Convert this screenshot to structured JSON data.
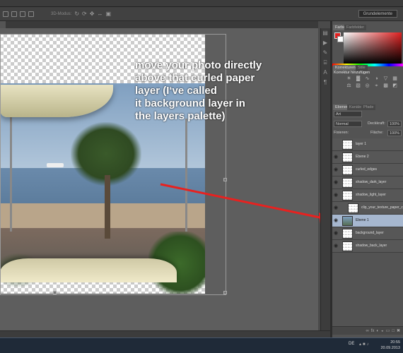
{
  "app": {
    "workspace_label": "Grundelemente",
    "options_label": "3D-Modus:"
  },
  "canvas": {
    "callout_lines": [
      "move your photo directly",
      "above that curled paper",
      "layer (I‘ve called",
      "it background layer in",
      "the layers palette)"
    ],
    "annotation_color": "#e8211f"
  },
  "color_panel": {
    "tabs": [
      "Farbe",
      "Farbfelder"
    ],
    "foreground": "#e02020",
    "background": "#ffffff"
  },
  "adjustments_panel": {
    "tabs": [
      "Korrekturen",
      "Stile"
    ],
    "heading": "Korrektur hinzufügen"
  },
  "layers_panel": {
    "tabs": [
      "Ebenen",
      "Kanäle",
      "Pfade"
    ],
    "filter": "Art",
    "blend_mode": "Normal",
    "opacity_label": "Deckkraft:",
    "opacity_value": "100%",
    "lock_label": "Fixieren:",
    "fill_label": "Fläche:",
    "fill_value": "100%",
    "layers": [
      {
        "name": "layer 1",
        "visible": false,
        "selected": false,
        "clip": false
      },
      {
        "name": "Ebene 2",
        "visible": true,
        "selected": false,
        "clip": false
      },
      {
        "name": "curled_edges",
        "visible": true,
        "selected": false,
        "clip": false
      },
      {
        "name": "shadow_dark_layer",
        "visible": true,
        "selected": false,
        "clip": false
      },
      {
        "name": "shadow_light_layer",
        "visible": true,
        "selected": false,
        "clip": false
      },
      {
        "name": "clip_your_texture_paper_col",
        "visible": true,
        "selected": false,
        "clip": true
      },
      {
        "name": "Ebene 1",
        "visible": true,
        "selected": true,
        "clip": false
      },
      {
        "name": "background_layer",
        "visible": true,
        "selected": false,
        "clip": false
      },
      {
        "name": "shadow_back_layer",
        "visible": true,
        "selected": false,
        "clip": false
      }
    ]
  },
  "taskbar": {
    "language": "DE",
    "time": "20:55",
    "date": "20.09.2013"
  }
}
